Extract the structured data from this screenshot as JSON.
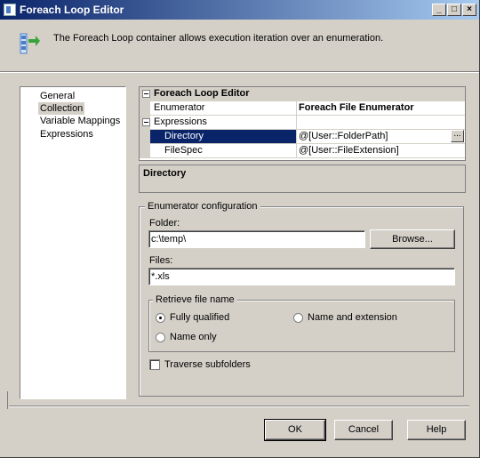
{
  "window": {
    "title": "Foreach Loop Editor"
  },
  "titlebar_buttons": {
    "minimize": "_",
    "maximize": "□",
    "close": "×"
  },
  "header": {
    "text": "The Foreach Loop container allows execution iteration over an enumeration."
  },
  "nav": {
    "items": [
      {
        "label": "General"
      },
      {
        "label": "Collection"
      },
      {
        "label": "Variable Mappings"
      },
      {
        "label": "Expressions"
      }
    ],
    "selected": "Collection"
  },
  "grid": {
    "category_main": "Foreach Loop Editor",
    "enumerator_label": "Enumerator",
    "enumerator_value": "Foreach File Enumerator",
    "category_expressions": "Expressions",
    "rows": [
      {
        "name": "Directory",
        "value": "@[User::FolderPath]"
      },
      {
        "name": "FileSpec",
        "value": "@[User::FileExtension]"
      }
    ],
    "ellipsis": "..."
  },
  "description": {
    "title": "Directory"
  },
  "enum_config": {
    "group_label": "Enumerator configuration",
    "folder_label": "Folder:",
    "folder_value": "c:\\temp\\",
    "browse_label": "Browse...",
    "files_label": "Files:",
    "files_value": "*.xls",
    "retrieve_label": "Retrieve file name",
    "radio_fully_qualified": "Fully qualified",
    "radio_name_extension": "Name and extension",
    "radio_name_only": "Name only",
    "traverse_label": "Traverse subfolders",
    "selected_radio": "Fully qualified",
    "traverse_checked": false
  },
  "footer": {
    "ok_label": "OK",
    "cancel_label": "Cancel",
    "help_label": "Help"
  }
}
